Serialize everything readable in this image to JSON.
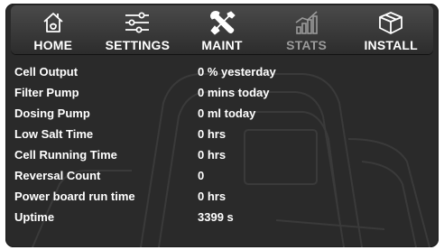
{
  "nav": {
    "items": [
      {
        "label": "HOME",
        "icon": "home-icon"
      },
      {
        "label": "SETTINGS",
        "icon": "sliders-icon"
      },
      {
        "label": "MAINT",
        "icon": "wrench-screwdriver-icon"
      },
      {
        "label": "STATS",
        "icon": "bar-chart-icon"
      },
      {
        "label": "INSTALL",
        "icon": "box-icon"
      }
    ]
  },
  "stats": {
    "rows": [
      {
        "label": "Cell Output",
        "value": "0 % yesterday"
      },
      {
        "label": "Filter Pump",
        "value": "0 mins today"
      },
      {
        "label": "Dosing Pump",
        "value": "0 ml today"
      },
      {
        "label": "Low Salt Time",
        "value": "0 hrs"
      },
      {
        "label": "Cell Running Time",
        "value": "0 hrs"
      },
      {
        "label": "Reversal Count",
        "value": "0"
      },
      {
        "label": "Power board run time",
        "value": "0 hrs"
      },
      {
        "label": "Uptime",
        "value": "3399 s"
      }
    ]
  },
  "colors": {
    "panel_bg": "#2a2a2a",
    "text": "#ffffff",
    "inactive_tab_text": "#9a9a9a"
  }
}
